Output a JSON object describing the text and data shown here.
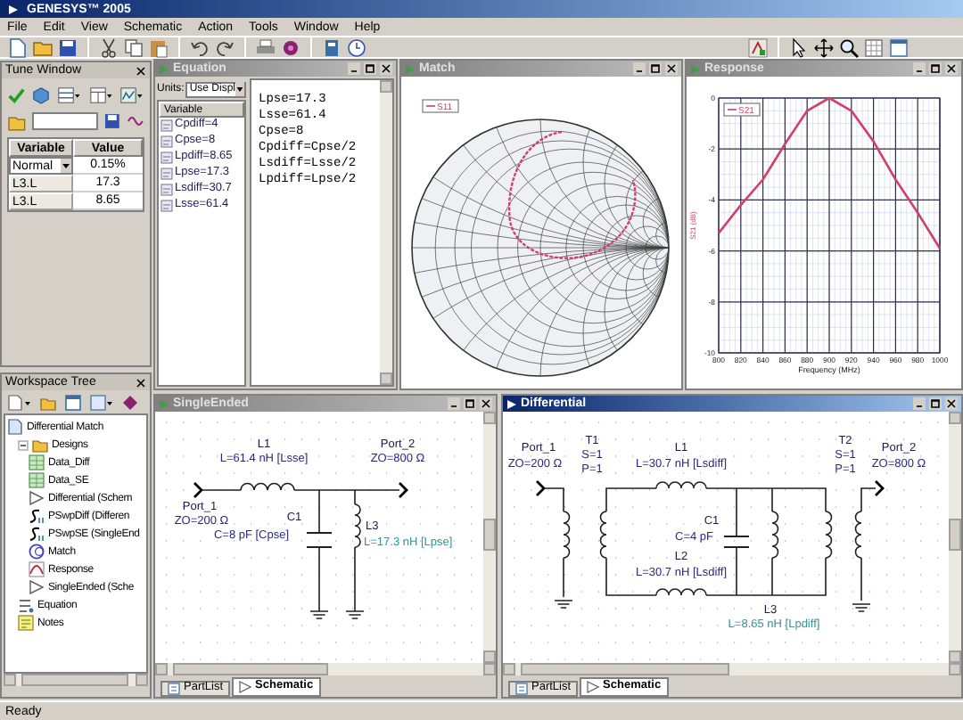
{
  "window": {
    "title": "GENESYS™ 2005"
  },
  "menu": [
    "File",
    "Edit",
    "View",
    "Schematic",
    "Action",
    "Tools",
    "Window",
    "Help"
  ],
  "tune_window": {
    "title": "Tune Window",
    "columns": [
      "Variable",
      "Value"
    ],
    "rows": [
      {
        "variable": "Normal",
        "value": "0.15%",
        "kind": "dropdown"
      },
      {
        "variable": "L3.L",
        "value": "17.3",
        "kind": "text"
      },
      {
        "variable": "L3.L",
        "value": "8.65",
        "kind": "text"
      }
    ]
  },
  "workspace_tree": {
    "title": "Workspace Tree",
    "items": [
      {
        "label": "Differential Match",
        "kind": "workspace",
        "children": [
          {
            "label": "Designs",
            "kind": "folder",
            "children": [
              {
                "label": "Data_Diff",
                "kind": "data"
              },
              {
                "label": "Data_SE",
                "kind": "data"
              },
              {
                "label": "Differential (Schem",
                "kind": "schematic"
              },
              {
                "label": "PSwpDiff (Differen",
                "kind": "sweep"
              },
              {
                "label": "PSwpSE (SingleEnd",
                "kind": "sweep"
              },
              {
                "label": "Match",
                "kind": "smith"
              },
              {
                "label": "Response",
                "kind": "graph"
              },
              {
                "label": "SingleEnded (Sche",
                "kind": "schematic"
              }
            ]
          },
          {
            "label": "Equation",
            "kind": "equation"
          },
          {
            "label": "Notes",
            "kind": "notes"
          }
        ]
      }
    ]
  },
  "equation": {
    "title": "Equation",
    "active": false,
    "units_label": "Units:",
    "units_value": "Use Displ",
    "list_header": "Variable",
    "variables": [
      "Cpdiff=4",
      "Cpse=8",
      "Lpdiff=8.65",
      "Lpse=17.3",
      "Lsdiff=30.7",
      "Lsse=61.4"
    ],
    "code_lines": [
      "Lpse=17.3",
      "Lsse=61.4",
      "Cpse=8",
      "Cpdiff=Cpse/2",
      "Lsdiff=Lsse/2",
      "Lpdiff=Lpse/2"
    ]
  },
  "match": {
    "title": "Match",
    "active": false,
    "legend": "S11"
  },
  "response": {
    "title": "Response",
    "active": false,
    "chart_data": {
      "type": "line",
      "xlabel": "Frequency (MHz)",
      "ylabel": "S21 (dB)",
      "categories": [
        "800",
        "820",
        "840",
        "860",
        "880",
        "900",
        "920",
        "940",
        "960",
        "980",
        "1000"
      ],
      "series": [
        {
          "name": "S21",
          "color": "#d0406a",
          "values": [
            -5.3,
            -4.2,
            -3.2,
            -1.8,
            -0.5,
            0,
            -0.5,
            -1.7,
            -3.2,
            -4.5,
            -5.9
          ]
        }
      ],
      "ylim": [
        -10,
        0
      ],
      "yticks": [
        0,
        -2,
        -4,
        -6,
        -8,
        -10
      ],
      "grid": true
    }
  },
  "single_ended": {
    "title": "SingleEnded",
    "active": false,
    "labels": [
      {
        "text": "L1",
        "kind": "name"
      },
      {
        "text": "L=61.4 nH [Lsse]",
        "kind": "value"
      },
      {
        "text": "Port_2",
        "kind": "name"
      },
      {
        "text": "ZO=800 Ω",
        "kind": "value"
      },
      {
        "text": "Port_1",
        "kind": "name"
      },
      {
        "text": "ZO=200 Ω",
        "kind": "value"
      },
      {
        "text": "C1",
        "kind": "name"
      },
      {
        "text": "C=8 pF [Cpse]",
        "kind": "value"
      },
      {
        "text": "L3",
        "kind": "name"
      },
      {
        "text": "L=17.3 nH [Lpse]",
        "kind": "tuned"
      }
    ],
    "tabs": [
      {
        "label": "PartList",
        "selected": false
      },
      {
        "label": "Schematic",
        "selected": true
      }
    ]
  },
  "differential": {
    "title": "Differential",
    "active": true,
    "labels": [
      {
        "text": "Port_1",
        "kind": "name"
      },
      {
        "text": "ZO=200 Ω",
        "kind": "value"
      },
      {
        "text": "T1",
        "kind": "name"
      },
      {
        "text": "S=1",
        "kind": "value"
      },
      {
        "text": "P=1",
        "kind": "value"
      },
      {
        "text": "L1",
        "kind": "name"
      },
      {
        "text": "L=30.7 nH [Lsdiff]",
        "kind": "value"
      },
      {
        "text": "C1",
        "kind": "name"
      },
      {
        "text": "C=4 pF",
        "kind": "value"
      },
      {
        "text": "L2",
        "kind": "name"
      },
      {
        "text": "L=30.7 nH [Lsdiff]",
        "kind": "value"
      },
      {
        "text": "L3",
        "kind": "name"
      },
      {
        "text": "L=8.65 nH [Lpdiff]",
        "kind": "tuned"
      },
      {
        "text": "T2",
        "kind": "name"
      },
      {
        "text": "S=1",
        "kind": "value"
      },
      {
        "text": "P=1",
        "kind": "value"
      },
      {
        "text": "Port_2",
        "kind": "name"
      },
      {
        "text": "ZO=800 Ω",
        "kind": "value"
      }
    ],
    "tabs": [
      {
        "label": "PartList",
        "selected": false
      },
      {
        "label": "Schematic",
        "selected": true
      }
    ]
  },
  "status_bar": {
    "text": "Ready"
  }
}
